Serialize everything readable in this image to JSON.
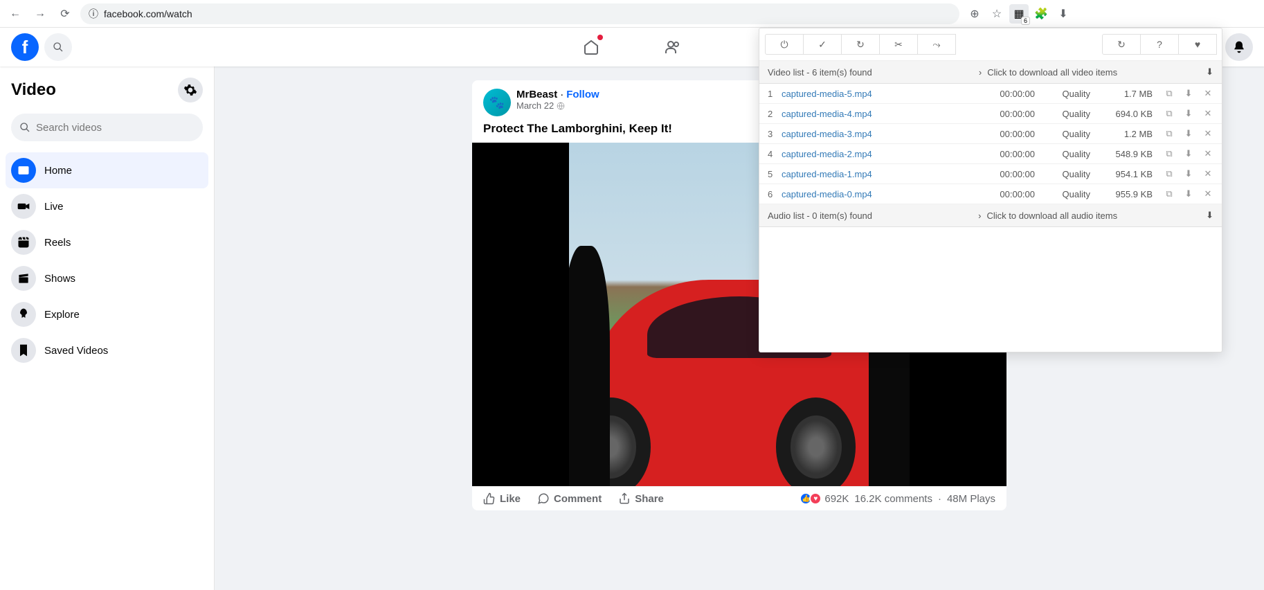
{
  "browser": {
    "url": "facebook.com/watch",
    "ext_count": "6"
  },
  "sidebar": {
    "title": "Video",
    "search_placeholder": "Search videos",
    "items": [
      {
        "label": "Home",
        "icon": "play"
      },
      {
        "label": "Live",
        "icon": "camera"
      },
      {
        "label": "Reels",
        "icon": "reel"
      },
      {
        "label": "Shows",
        "icon": "clapper"
      },
      {
        "label": "Explore",
        "icon": "rocket"
      },
      {
        "label": "Saved Videos",
        "icon": "bookmark"
      }
    ]
  },
  "post": {
    "author": "MrBeast",
    "follow": "Follow",
    "sep": " · ",
    "date": "March 22",
    "title": "Protect The Lamborghini, Keep It!",
    "like": "Like",
    "comment": "Comment",
    "share": "Share",
    "reactions": "692K",
    "comments": "16.2K comments",
    "plays": "48M Plays",
    "stats_sep": " · "
  },
  "popup": {
    "video_header": "Video list - 6 item(s) found",
    "video_click": "Click to download all video items",
    "audio_header": "Audio list - 0 item(s) found",
    "audio_click": "Click to download all audio items",
    "items": [
      {
        "idx": "1",
        "name": "captured-media-5.mp4",
        "dur": "00:00:00",
        "quality": "Quality",
        "size": "1.7 MB"
      },
      {
        "idx": "2",
        "name": "captured-media-4.mp4",
        "dur": "00:00:00",
        "quality": "Quality",
        "size": "694.0 KB"
      },
      {
        "idx": "3",
        "name": "captured-media-3.mp4",
        "dur": "00:00:00",
        "quality": "Quality",
        "size": "1.2 MB"
      },
      {
        "idx": "4",
        "name": "captured-media-2.mp4",
        "dur": "00:00:00",
        "quality": "Quality",
        "size": "548.9 KB"
      },
      {
        "idx": "5",
        "name": "captured-media-1.mp4",
        "dur": "00:00:00",
        "quality": "Quality",
        "size": "954.1 KB"
      },
      {
        "idx": "6",
        "name": "captured-media-0.mp4",
        "dur": "00:00:00",
        "quality": "Quality",
        "size": "955.9 KB"
      }
    ]
  }
}
